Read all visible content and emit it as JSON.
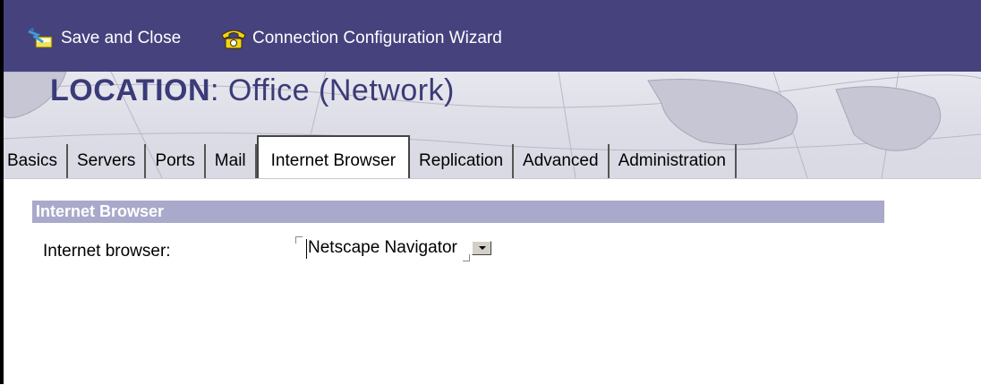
{
  "toolbar": {
    "save_close_label": "Save and Close",
    "wizard_label": "Connection Configuration Wizard",
    "save_close_icon": "save-close-icon",
    "wizard_icon": "telephone-icon"
  },
  "banner": {
    "location_label": "LOCATION",
    "location_value": ": Office (Network)"
  },
  "tabs": [
    {
      "label": "Basics",
      "active": false
    },
    {
      "label": "Servers",
      "active": false
    },
    {
      "label": "Ports",
      "active": false
    },
    {
      "label": "Mail",
      "active": false
    },
    {
      "label": "Internet Browser",
      "active": true
    },
    {
      "label": "Replication",
      "active": false
    },
    {
      "label": "Advanced",
      "active": false
    },
    {
      "label": "Administration",
      "active": false
    }
  ],
  "section": {
    "title": "Internet Browser",
    "field_label": "Internet browser:",
    "field_value": "Netscape Navigator"
  },
  "colors": {
    "action_bar": "#46427e",
    "section_header": "#a9a9cb",
    "title_text": "#3b3b78"
  }
}
